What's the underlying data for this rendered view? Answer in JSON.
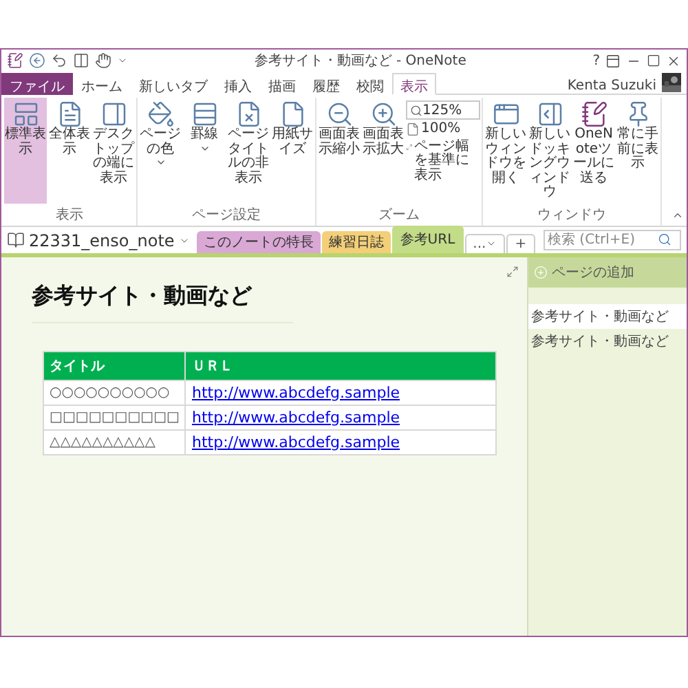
{
  "window": {
    "title": "参考サイト・動画など - OneNote",
    "help": "?",
    "user": "Kenta Suzuki"
  },
  "menu_tabs": [
    {
      "label": "ファイル",
      "kind": "file",
      "selected": false
    },
    {
      "label": "ホーム",
      "kind": "tab",
      "selected": false
    },
    {
      "label": "新しいタブ",
      "kind": "tab",
      "selected": false
    },
    {
      "label": "挿入",
      "kind": "tab",
      "selected": false
    },
    {
      "label": "描画",
      "kind": "tab",
      "selected": false
    },
    {
      "label": "履歴",
      "kind": "tab",
      "selected": false
    },
    {
      "label": "校閲",
      "kind": "tab",
      "selected": false
    },
    {
      "label": "表示",
      "kind": "tab",
      "selected": true
    }
  ],
  "ribbon_groups": [
    {
      "label": "表示",
      "kind": "buttons",
      "buttons": [
        {
          "label": "標準表示",
          "selected": true
        },
        {
          "label": "全体表示",
          "selected": false
        },
        {
          "label": "デスクトップの端に表示",
          "selected": false
        }
      ]
    },
    {
      "label": "ページ設定",
      "kind": "buttons",
      "buttons": [
        {
          "label": "ページの色",
          "selected": false,
          "dropdown": true
        },
        {
          "label": "罫線",
          "selected": false,
          "dropdown": true
        },
        {
          "label": "ページタイトルの非表示",
          "selected": false
        },
        {
          "label": "用紙サイズ",
          "selected": false
        }
      ]
    },
    {
      "label": "ズーム",
      "kind": "zoom",
      "buttons": [
        {
          "label": "画面表示縮小",
          "selected": false
        },
        {
          "label": "画面表示拡大",
          "selected": false
        }
      ],
      "zoom_value": "125%",
      "small_buttons": [
        "100%",
        "ページ幅を基準に表示"
      ]
    },
    {
      "label": "ウィンドウ",
      "kind": "buttons",
      "buttons": [
        {
          "label": "新しいウィンドウを開く",
          "selected": false
        },
        {
          "label": "新しいドッキングウィンドウ",
          "selected": false
        },
        {
          "label": "OneNoteツールに送る",
          "selected": false
        },
        {
          "label": "常に手前に表示",
          "selected": false
        }
      ]
    }
  ],
  "notebook": {
    "name": "22331_enso_note"
  },
  "sections": [
    {
      "label": "このノートの特長",
      "color": "#d9a8d5",
      "selected": false
    },
    {
      "label": "練習日誌",
      "color": "#f3cf78",
      "selected": false
    },
    {
      "label": "参考URL",
      "color": "#c3dc88",
      "selected": true
    }
  ],
  "section_more": "...",
  "section_add": "+",
  "search": {
    "placeholder": "検索 (Ctrl+E)"
  },
  "page": {
    "title": "参考サイト・動画など",
    "table": {
      "columns": [
        "タイトル",
        "ＵＲＬ"
      ],
      "rows": [
        [
          "○○○○○○○○○○",
          "http://www.abcdefg.sample"
        ],
        [
          "□□□□□□□□□□",
          "http://www.abcdefg.sample"
        ],
        [
          "△△△△△△△△△△",
          "http://www.abcdefg.sample"
        ]
      ]
    }
  },
  "pages_panel": {
    "add_label": "ページの追加",
    "pages": [
      {
        "title": "参考サイト・動画など",
        "selected": true
      },
      {
        "title": "参考サイト・動画など",
        "selected": false
      }
    ]
  }
}
